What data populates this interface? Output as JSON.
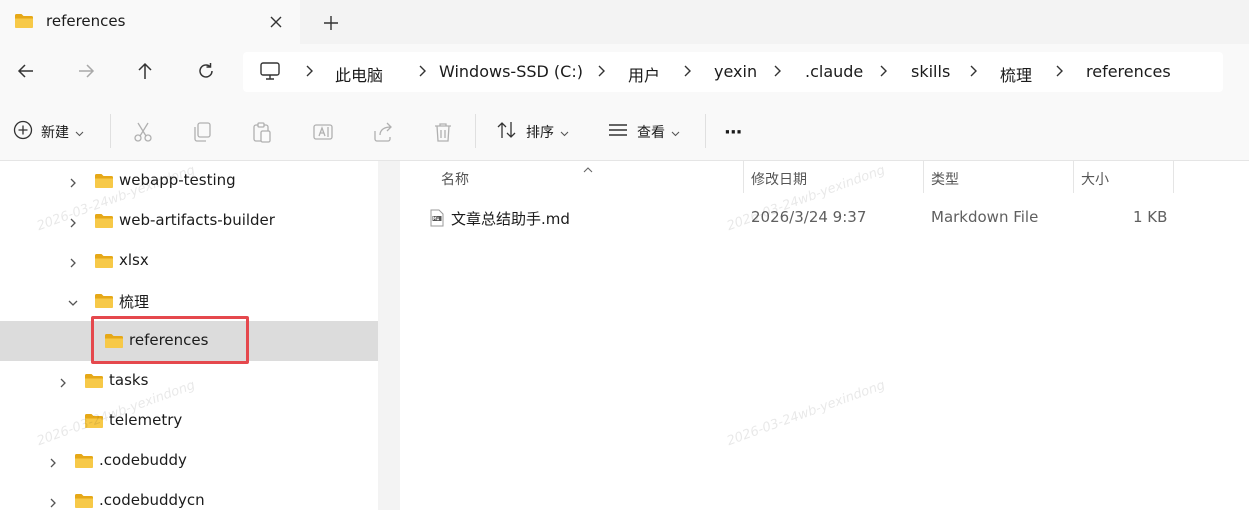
{
  "tab": {
    "title": "references",
    "close_icon": "close-icon",
    "new_tab_icon": "plus-icon"
  },
  "nav": {
    "back_icon": "arrow-left-icon",
    "forward_icon": "arrow-right-icon",
    "up_icon": "arrow-up-icon",
    "refresh_icon": "refresh-icon"
  },
  "breadcrumb": {
    "root_icon": "monitor-icon",
    "items": [
      "此电脑",
      "Windows-SSD (C:)",
      "用户",
      "yexin",
      ".claude",
      "skills",
      "梳理",
      "references"
    ]
  },
  "toolbar": {
    "new_label": "新建",
    "sort_label": "排序",
    "view_label": "查看",
    "more_label": "···",
    "icons": [
      "cut-icon",
      "copy-icon",
      "paste-icon",
      "rename-icon",
      "share-icon",
      "delete-icon"
    ]
  },
  "sidebar": {
    "items": [
      {
        "label": "webapp-testing",
        "expanded": false
      },
      {
        "label": "web-artifacts-builder",
        "expanded": false
      },
      {
        "label": "xlsx",
        "expanded": false
      },
      {
        "label": "梳理",
        "expanded": true
      },
      {
        "label": "references",
        "selected": true
      },
      {
        "label": "tasks",
        "expanded": false
      },
      {
        "label": "telemetry"
      },
      {
        "label": ".codebuddy",
        "expanded": false
      },
      {
        "label": ".codebuddycn",
        "expanded": false
      }
    ]
  },
  "columns": {
    "name": "名称",
    "date": "修改日期",
    "type": "类型",
    "size": "大小"
  },
  "files": [
    {
      "name": "文章总结助手.md",
      "date": "2026/3/24 9:37",
      "type": "Markdown File",
      "size": "1 KB"
    }
  ],
  "watermark": "2026-03-24wb-yexindong",
  "colors": {
    "folder": "#f7c948",
    "folder_dark": "#e6a817",
    "highlight": "#e5484d",
    "selected_row": "#dcdcdc"
  }
}
